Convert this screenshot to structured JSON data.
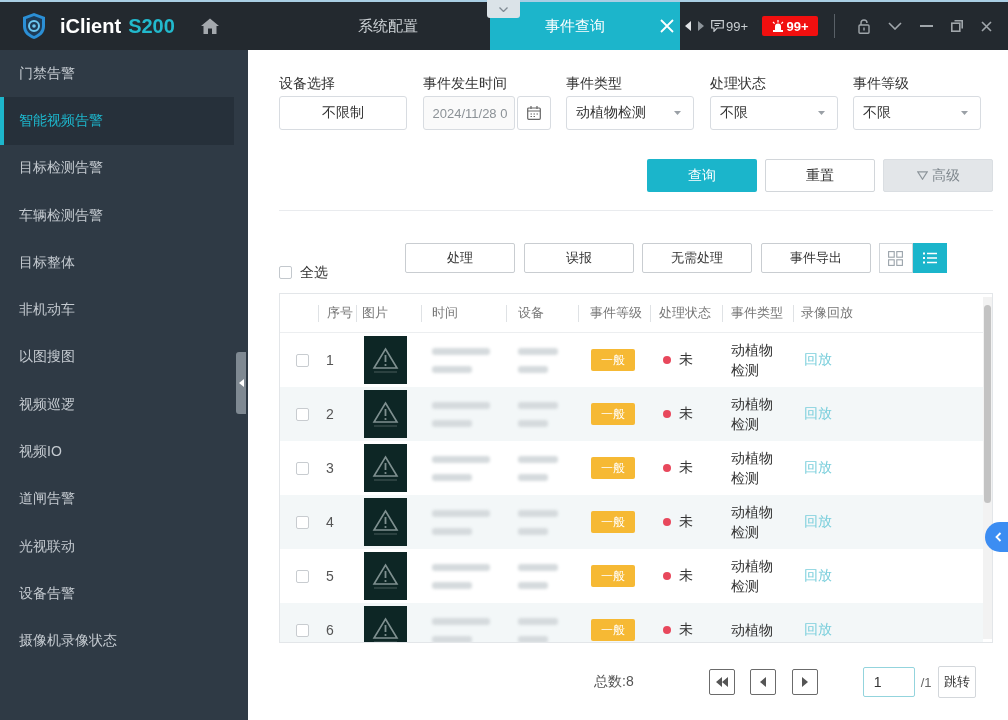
{
  "app": {
    "name": "iClient",
    "model": "S200"
  },
  "tabs": [
    {
      "label": "系统配置",
      "selected": false,
      "closable": false
    },
    {
      "label": "事件查询",
      "selected": true,
      "closable": true
    }
  ],
  "notifications": {
    "messages": "99+",
    "alarms": "99+"
  },
  "sidebar": {
    "items": [
      {
        "label": "门禁告警",
        "selected": false
      },
      {
        "label": "智能视频告警",
        "selected": true
      },
      {
        "label": "目标检测告警",
        "selected": false
      },
      {
        "label": "车辆检测告警",
        "selected": false
      },
      {
        "label": "目标整体",
        "selected": false
      },
      {
        "label": "非机动车",
        "selected": false
      },
      {
        "label": "以图搜图",
        "selected": false
      },
      {
        "label": "视频巡逻",
        "selected": false
      },
      {
        "label": "视频IO",
        "selected": false
      },
      {
        "label": "道闸告警",
        "selected": false
      },
      {
        "label": "光视联动",
        "selected": false
      },
      {
        "label": "设备告警",
        "selected": false
      },
      {
        "label": "摄像机录像状态",
        "selected": false
      }
    ]
  },
  "filters": [
    {
      "label": "设备选择",
      "kind": "picker",
      "value": "不限制"
    },
    {
      "label": "事件发生时间",
      "kind": "date",
      "value": "2024/11/28 0"
    },
    {
      "label": "事件类型",
      "kind": "select",
      "value": "动植物检测"
    },
    {
      "label": "处理状态",
      "kind": "select",
      "value": "不限"
    },
    {
      "label": "事件等级",
      "kind": "select",
      "value": "不限"
    }
  ],
  "query_buttons": [
    {
      "label": "查询",
      "kind": "primary",
      "disabled": false
    },
    {
      "label": "重置",
      "kind": "default",
      "disabled": false
    },
    {
      "label": "高级",
      "kind": "expander",
      "disabled": true
    }
  ],
  "select_all": {
    "label": "全选",
    "checked": false
  },
  "bulk_actions": [
    "处理",
    "误报",
    "无需处理",
    "事件导出"
  ],
  "view_modes": [
    {
      "kind": "grid",
      "selected": false
    },
    {
      "kind": "list",
      "selected": true
    }
  ],
  "table": {
    "columns": [
      "序号",
      "图片",
      "时间",
      "设备",
      "事件等级",
      "处理状态",
      "事件类型",
      "录像回放"
    ],
    "rows": [
      {
        "checked": false,
        "number": "1",
        "time_blurred": true,
        "device_blurred": true,
        "grade": "一般",
        "status": {
          "text": "未",
          "color": "#e8485c"
        },
        "type": "动植物检测",
        "playback": "回放"
      },
      {
        "checked": false,
        "number": "2",
        "time_blurred": true,
        "device_blurred": true,
        "grade": "一般",
        "status": {
          "text": "未",
          "color": "#e8485c"
        },
        "type": "动植物检测",
        "playback": "回放"
      },
      {
        "checked": false,
        "number": "3",
        "time_blurred": true,
        "device_blurred": true,
        "grade": "一般",
        "status": {
          "text": "未",
          "color": "#e8485c"
        },
        "type": "动植物检测",
        "playback": "回放"
      },
      {
        "checked": false,
        "number": "4",
        "time_blurred": true,
        "device_blurred": true,
        "grade": "一般",
        "status": {
          "text": "未",
          "color": "#e8485c"
        },
        "type": "动植物检测",
        "playback": "回放"
      },
      {
        "checked": false,
        "number": "5",
        "time_blurred": true,
        "device_blurred": true,
        "grade": "一般",
        "status": {
          "text": "未",
          "color": "#e8485c"
        },
        "type": "动植物检测",
        "playback": "回放"
      },
      {
        "checked": false,
        "number": "6",
        "time_blurred": true,
        "device_blurred": true,
        "grade": "一般",
        "status": {
          "text": "未",
          "color": "#e8485c"
        },
        "type": "动植物",
        "playback": "回放"
      }
    ]
  },
  "pagination": {
    "total": "总数:8",
    "page": "1",
    "page_count": "/1",
    "jump": "跳转"
  }
}
